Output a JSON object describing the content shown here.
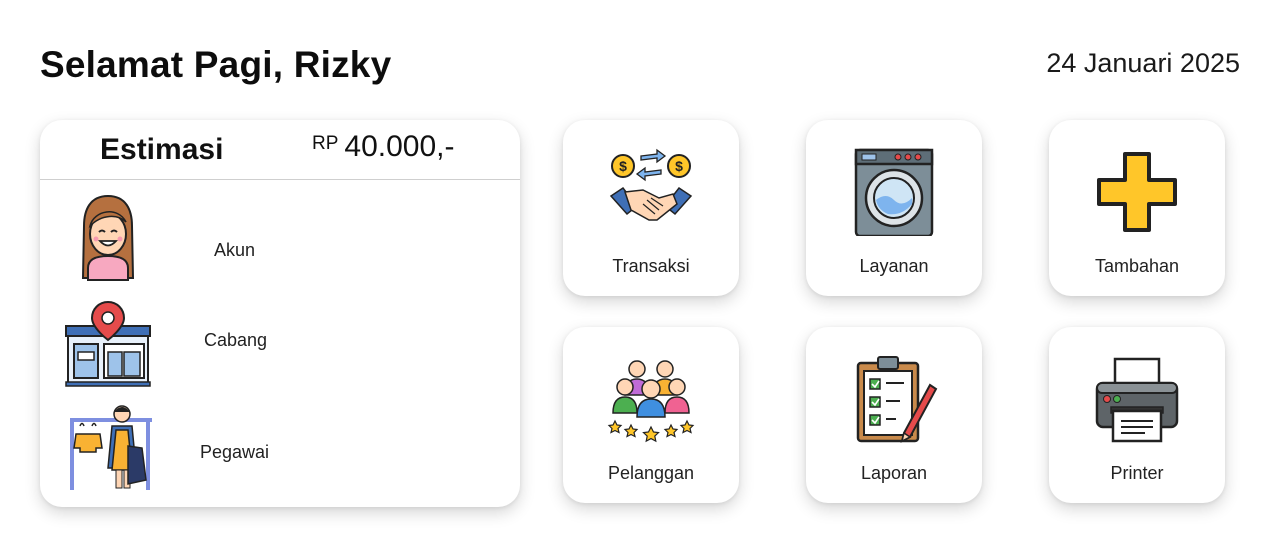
{
  "header": {
    "greeting": "Selamat Pagi, Rizky",
    "date": "24 Januari 2025"
  },
  "estimate": {
    "title": "Estimasi",
    "currency": "RP",
    "amount": "40.000,-",
    "items": [
      {
        "label": "Akun",
        "icon": "user-avatar-icon"
      },
      {
        "label": "Cabang",
        "icon": "store-location-icon"
      },
      {
        "label": "Pegawai",
        "icon": "employee-laundry-icon"
      }
    ]
  },
  "menu": [
    {
      "label": "Transaksi",
      "icon": "handshake-money-icon"
    },
    {
      "label": "Layanan",
      "icon": "washing-machine-icon"
    },
    {
      "label": "Tambahan",
      "icon": "plus-icon"
    },
    {
      "label": "Pelanggan",
      "icon": "customers-rating-icon"
    },
    {
      "label": "Laporan",
      "icon": "clipboard-report-icon"
    },
    {
      "label": "Printer",
      "icon": "printer-icon"
    }
  ],
  "colors": {
    "accent_yellow": "#FFC629",
    "background": "#FFFFFF",
    "text": "#111111"
  }
}
